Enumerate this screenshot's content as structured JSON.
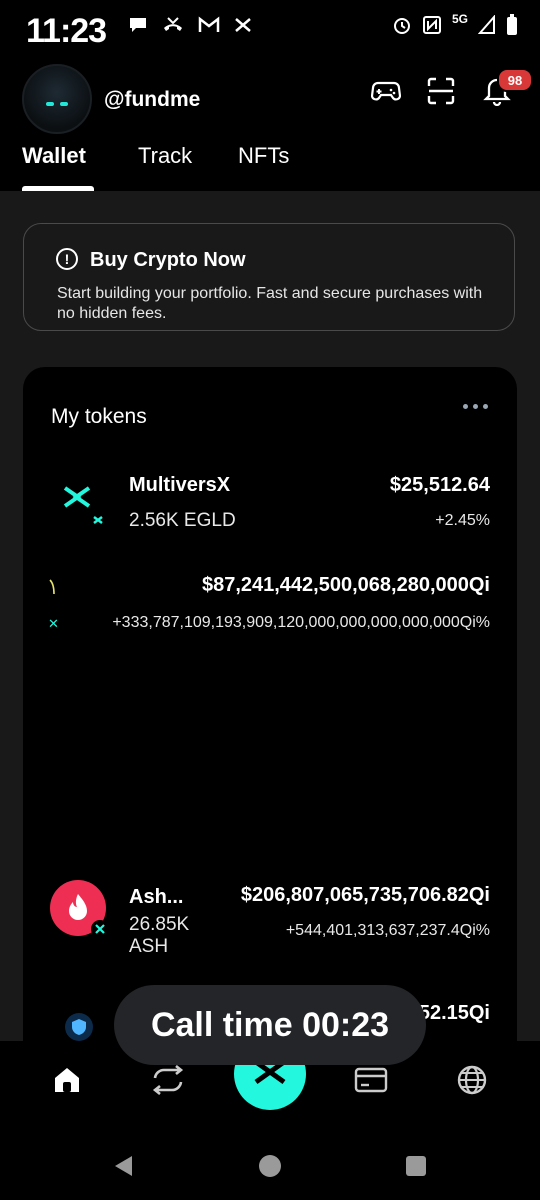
{
  "status_bar": {
    "time": "11:23",
    "network": "5G"
  },
  "header": {
    "username": "@fundme",
    "notification_count": "98"
  },
  "tabs": [
    {
      "label": "Wallet",
      "active": true
    },
    {
      "label": "Track",
      "active": false
    },
    {
      "label": "NFTs",
      "active": false
    }
  ],
  "buy_card": {
    "title": "Buy Crypto Now",
    "description": "Start building your portfolio. Fast and secure purchases with no hidden fees."
  },
  "tokens": {
    "title": "My tokens",
    "items": [
      {
        "name": "MultiversX",
        "amount": "2.56K EGLD",
        "value": "$25,512.64",
        "change": "+2.45%"
      },
      {
        "name": "",
        "amount": "",
        "value": "$87,241,442,500,068,280,000Qi",
        "change": "+333,787,109,193,909,120,000,000,000,000,000Qi%"
      },
      {
        "name": "Ash...",
        "amount": "26.85K ASH",
        "value": "$206,807,065,735,706.82Qi",
        "change": "+544,401,313,637,237.4Qi%"
      },
      {
        "name": "",
        "amount": "",
        "value": "52.15Qi",
        "change": ""
      }
    ]
  },
  "overlay": {
    "call_time": "Call time 00:23"
  },
  "colors": {
    "accent": "#23f7dd",
    "badge": "#d93838",
    "ash": "#ee2e52"
  }
}
